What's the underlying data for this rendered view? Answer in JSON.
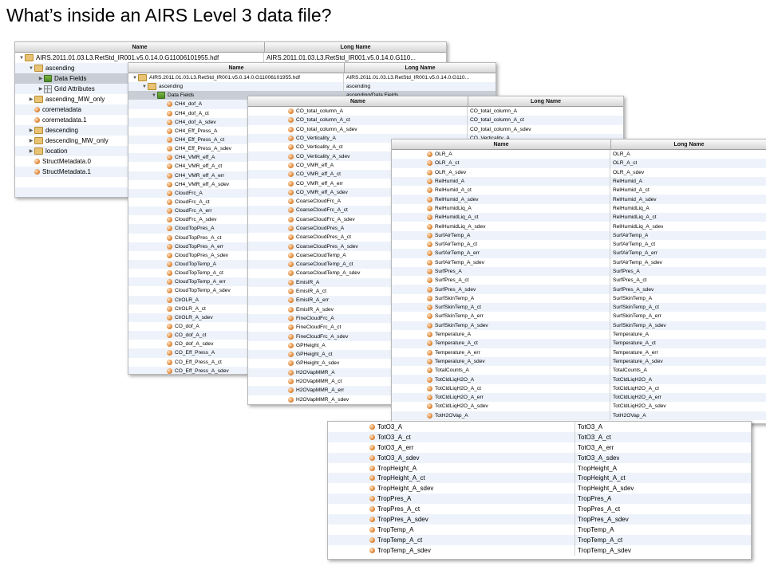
{
  "slide_title": "What’s inside an AIRS Level 3 data file?",
  "headers": {
    "name": "Name",
    "long_name": "Long Name"
  },
  "pane1": {
    "rows": [
      {
        "name": "AIRS.2011.01.03.L3.RetStd_IR001.v5.0.14.0.G11006101955.hdf",
        "long": "AIRS.2011.01.03.L3.RetStd_IR001.v5.0.14.0.G110...",
        "indent": 0,
        "tri": "down",
        "icon": "folder"
      },
      {
        "name": "ascending",
        "long": "",
        "indent": 1,
        "tri": "down",
        "icon": "folder"
      },
      {
        "name": "Data Fields",
        "long": "",
        "indent": 2,
        "tri": "right",
        "icon": "data",
        "sel": true
      },
      {
        "name": "Grid Attributes",
        "long": "",
        "indent": 2,
        "tri": "right",
        "icon": "grid"
      },
      {
        "name": "ascending_MW_only",
        "long": "",
        "indent": 1,
        "tri": "right",
        "icon": "folder"
      },
      {
        "name": "coremetadata",
        "long": "",
        "indent": 1,
        "tri": "",
        "icon": "file"
      },
      {
        "name": "coremetadata.1",
        "long": "",
        "indent": 1,
        "tri": "",
        "icon": "file"
      },
      {
        "name": "descending",
        "long": "",
        "indent": 1,
        "tri": "right",
        "icon": "folder"
      },
      {
        "name": "descending_MW_only",
        "long": "",
        "indent": 1,
        "tri": "right",
        "icon": "folder"
      },
      {
        "name": "location",
        "long": "",
        "indent": 1,
        "tri": "right",
        "icon": "folder"
      },
      {
        "name": "StructMetadata.0",
        "long": "",
        "indent": 1,
        "tri": "",
        "icon": "file"
      },
      {
        "name": "StructMetadata.1",
        "long": "",
        "indent": 1,
        "tri": "",
        "icon": "file"
      },
      {
        "name": "",
        "long": "",
        "indent": 0,
        "tri": "",
        "icon": ""
      },
      {
        "name": "",
        "long": "",
        "indent": 0,
        "tri": "",
        "icon": ""
      }
    ]
  },
  "pane2": {
    "rows": [
      {
        "name": "AIRS.2011.01.03.L3.RetStd_IR001.v5.0.14.0.G11006101955.hdf",
        "long": "AIRS.2011.01.03.L3.RetStd_IR001.v5.0.14.0.G110...",
        "indent": 0,
        "tri": "down",
        "icon": "folder"
      },
      {
        "name": "ascending",
        "long": "ascending",
        "indent": 1,
        "tri": "down",
        "icon": "folder"
      },
      {
        "name": "Data Fields",
        "long": "ascending/Data Fields",
        "indent": 2,
        "tri": "down",
        "icon": "data",
        "sel": true
      },
      {
        "name": "CH4_dof_A",
        "icon": "file",
        "indent": 3
      },
      {
        "name": "CH4_dof_A_ct",
        "icon": "file",
        "indent": 3
      },
      {
        "name": "CH4_dof_A_sdev",
        "icon": "file",
        "indent": 3
      },
      {
        "name": "CH4_Eff_Press_A",
        "icon": "file",
        "indent": 3
      },
      {
        "name": "CH4_Eff_Press_A_ct",
        "icon": "file",
        "indent": 3
      },
      {
        "name": "CH4_Eff_Press_A_sdev",
        "icon": "file",
        "indent": 3
      },
      {
        "name": "CH4_VMR_eff_A",
        "icon": "file",
        "indent": 3
      },
      {
        "name": "CH4_VMR_eff_A_ct",
        "icon": "file",
        "indent": 3
      },
      {
        "name": "CH4_VMR_eff_A_err",
        "icon": "file",
        "indent": 3
      },
      {
        "name": "CH4_VMR_eff_A_sdev",
        "icon": "file",
        "indent": 3
      },
      {
        "name": "CloudFrc_A",
        "icon": "file",
        "indent": 3
      },
      {
        "name": "CloudFrc_A_ct",
        "icon": "file",
        "indent": 3
      },
      {
        "name": "CloudFrc_A_err",
        "icon": "file",
        "indent": 3
      },
      {
        "name": "CloudFrc_A_sdev",
        "icon": "file",
        "indent": 3
      },
      {
        "name": "CloudTopPres_A",
        "icon": "file",
        "indent": 3
      },
      {
        "name": "CloudTopPres_A_ct",
        "icon": "file",
        "indent": 3
      },
      {
        "name": "CloudTopPres_A_err",
        "icon": "file",
        "indent": 3
      },
      {
        "name": "CloudTopPres_A_sdev",
        "icon": "file",
        "indent": 3
      },
      {
        "name": "CloudTopTemp_A",
        "icon": "file",
        "indent": 3
      },
      {
        "name": "CloudTopTemp_A_ct",
        "icon": "file",
        "indent": 3
      },
      {
        "name": "CloudTopTemp_A_err",
        "icon": "file",
        "indent": 3
      },
      {
        "name": "CloudTopTemp_A_sdev",
        "icon": "file",
        "indent": 3
      },
      {
        "name": "ClrOLR_A",
        "icon": "file",
        "indent": 3
      },
      {
        "name": "ClrOLR_A_ct",
        "icon": "file",
        "indent": 3
      },
      {
        "name": "ClrOLR_A_sdev",
        "icon": "file",
        "indent": 3
      },
      {
        "name": "CO_dof_A",
        "icon": "file",
        "indent": 3
      },
      {
        "name": "CO_dof_A_ct",
        "icon": "file",
        "indent": 3
      },
      {
        "name": "CO_dof_A_sdev",
        "icon": "file",
        "indent": 3
      },
      {
        "name": "CO_Eff_Press_A",
        "icon": "file",
        "indent": 3
      },
      {
        "name": "CO_Eff_Press_A_ct",
        "icon": "file",
        "indent": 3
      },
      {
        "name": "CO_Eff_Press_A_sdev",
        "icon": "file",
        "indent": 3
      }
    ]
  },
  "pane3": {
    "rows": [
      {
        "name": "CO_total_column_A",
        "long": "CO_total_column_A"
      },
      {
        "name": "CO_total_column_A_ct",
        "long": "CO_total_column_A_ct"
      },
      {
        "name": "CO_total_column_A_sdev",
        "long": "CO_total_column_A_sdev"
      },
      {
        "name": "CO_Verticality_A",
        "long": "CO_Verticality_A"
      },
      {
        "name": "CO_Verticality_A_ct",
        "long": ""
      },
      {
        "name": "CO_Verticality_A_sdev",
        "long": ""
      },
      {
        "name": "CO_VMR_eff_A",
        "long": ""
      },
      {
        "name": "CO_VMR_eff_A_ct",
        "long": ""
      },
      {
        "name": "CO_VMR_eff_A_err",
        "long": ""
      },
      {
        "name": "CO_VMR_eff_A_sdev",
        "long": ""
      },
      {
        "name": "CoarseCloudFrc_A",
        "long": ""
      },
      {
        "name": "CoarseCloudFrc_A_ct",
        "long": ""
      },
      {
        "name": "CoarseCloudFrc_A_sdev",
        "long": ""
      },
      {
        "name": "CoarseCloudPres_A",
        "long": ""
      },
      {
        "name": "CoarseCloudPres_A_ct",
        "long": ""
      },
      {
        "name": "CoarseCloudPres_A_sdev",
        "long": ""
      },
      {
        "name": "CoarseCloudTemp_A",
        "long": ""
      },
      {
        "name": "CoarseCloudTemp_A_ct",
        "long": ""
      },
      {
        "name": "CoarseCloudTemp_A_sdev",
        "long": ""
      },
      {
        "name": "EmisIR_A",
        "long": ""
      },
      {
        "name": "EmisIR_A_ct",
        "long": ""
      },
      {
        "name": "EmisIR_A_err",
        "long": ""
      },
      {
        "name": "EmisIR_A_sdev",
        "long": ""
      },
      {
        "name": "FineCloudFrc_A",
        "long": ""
      },
      {
        "name": "FineCloudFrc_A_ct",
        "long": ""
      },
      {
        "name": "FineCloudFrc_A_sdev",
        "long": ""
      },
      {
        "name": "GPHeight_A",
        "long": ""
      },
      {
        "name": "GPHeight_A_ct",
        "long": ""
      },
      {
        "name": "GPHeight_A_sdev",
        "long": ""
      },
      {
        "name": "H2OVapMMR_A",
        "long": ""
      },
      {
        "name": "H2OVapMMR_A_ct",
        "long": ""
      },
      {
        "name": "H2OVapMMR_A_err",
        "long": ""
      },
      {
        "name": "H2OVapMMR_A_sdev",
        "long": ""
      }
    ]
  },
  "pane4": {
    "rows": [
      {
        "name": "OLR_A",
        "long": "OLR_A"
      },
      {
        "name": "OLR_A_ct",
        "long": "OLR_A_ct"
      },
      {
        "name": "OLR_A_sdev",
        "long": "OLR_A_sdev"
      },
      {
        "name": "RelHumid_A",
        "long": "RelHumid_A"
      },
      {
        "name": "RelHumid_A_ct",
        "long": "RelHumid_A_ct"
      },
      {
        "name": "RelHumid_A_sdev",
        "long": "RelHumid_A_sdev"
      },
      {
        "name": "RelHumidLiq_A",
        "long": "RelHumidLiq_A"
      },
      {
        "name": "RelHumidLiq_A_ct",
        "long": "RelHumidLiq_A_ct"
      },
      {
        "name": "RelHumidLiq_A_sdev",
        "long": "RelHumidLiq_A_sdev"
      },
      {
        "name": "SurfAirTemp_A",
        "long": "SurfAirTemp_A"
      },
      {
        "name": "SurfAirTemp_A_ct",
        "long": "SurfAirTemp_A_ct"
      },
      {
        "name": "SurfAirTemp_A_err",
        "long": "SurfAirTemp_A_err"
      },
      {
        "name": "SurfAirTemp_A_sdev",
        "long": "SurfAirTemp_A_sdev"
      },
      {
        "name": "SurfPres_A",
        "long": "SurfPres_A"
      },
      {
        "name": "SurfPres_A_ct",
        "long": "SurfPres_A_ct"
      },
      {
        "name": "SurfPres_A_sdev",
        "long": "SurfPres_A_sdev"
      },
      {
        "name": "SurfSkinTemp_A",
        "long": "SurfSkinTemp_A"
      },
      {
        "name": "SurfSkinTemp_A_ct",
        "long": "SurfSkinTemp_A_ct"
      },
      {
        "name": "SurfSkinTemp_A_err",
        "long": "SurfSkinTemp_A_err"
      },
      {
        "name": "SurfSkinTemp_A_sdev",
        "long": "SurfSkinTemp_A_sdev"
      },
      {
        "name": "Temperature_A",
        "long": "Temperature_A"
      },
      {
        "name": "Temperature_A_ct",
        "long": "Temperature_A_ct"
      },
      {
        "name": "Temperature_A_err",
        "long": "Temperature_A_err"
      },
      {
        "name": "Temperature_A_sdev",
        "long": "Temperature_A_sdev"
      },
      {
        "name": "TotalCounts_A",
        "long": "TotalCounts_A"
      },
      {
        "name": "TotCldLiqH2O_A",
        "long": "TotCldLiqH2O_A"
      },
      {
        "name": "TotCldLiqH2O_A_ct",
        "long": "TotCldLiqH2O_A_ct"
      },
      {
        "name": "TotCldLiqH2O_A_err",
        "long": "TotCldLiqH2O_A_err"
      },
      {
        "name": "TotCldLiqH2O_A_sdev",
        "long": "TotCldLiqH2O_A_sdev"
      },
      {
        "name": "TotH2OVap_A",
        "long": "TotH2OVap_A"
      }
    ]
  },
  "pane5": {
    "rows": [
      {
        "name": "TotO3_A",
        "long": "TotO3_A"
      },
      {
        "name": "TotO3_A_ct",
        "long": "TotO3_A_ct"
      },
      {
        "name": "TotO3_A_err",
        "long": "TotO3_A_err"
      },
      {
        "name": "TotO3_A_sdev",
        "long": "TotO3_A_sdev"
      },
      {
        "name": "TropHeight_A",
        "long": "TropHeight_A"
      },
      {
        "name": "TropHeight_A_ct",
        "long": "TropHeight_A_ct"
      },
      {
        "name": "TropHeight_A_sdev",
        "long": "TropHeight_A_sdev"
      },
      {
        "name": "TropPres_A",
        "long": "TropPres_A"
      },
      {
        "name": "TropPres_A_ct",
        "long": "TropPres_A_ct"
      },
      {
        "name": "TropPres_A_sdev",
        "long": "TropPres_A_sdev"
      },
      {
        "name": "TropTemp_A",
        "long": "TropTemp_A"
      },
      {
        "name": "TropTemp_A_ct",
        "long": "TropTemp_A_ct"
      },
      {
        "name": "TropTemp_A_sdev",
        "long": "TropTemp_A_sdev"
      }
    ]
  }
}
